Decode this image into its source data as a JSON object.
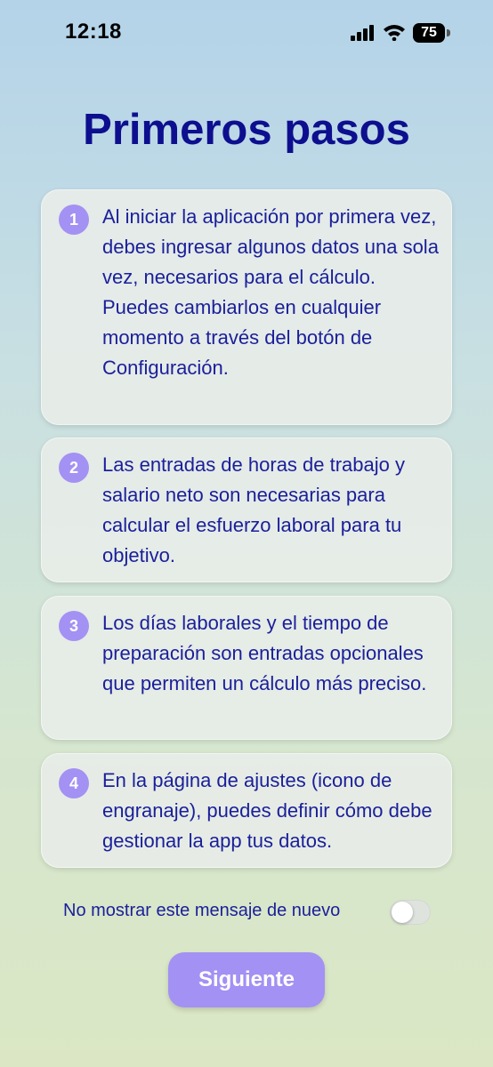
{
  "status_bar": {
    "time": "12:18",
    "battery": "75"
  },
  "title": "Primeros pasos",
  "steps": [
    {
      "number": "1",
      "text": "Al iniciar la aplicación por primera vez, debes ingresar algunos datos una sola vez, necesarios para el cálculo. Puedes cambiarlos en cualquier momento a través del botón de Configuración."
    },
    {
      "number": "2",
      "text": "Las entradas de horas de trabajo y salario neto son necesarias para calcular el esfuerzo laboral para tu objetivo."
    },
    {
      "number": "3",
      "text": "Los días laborales y el tiempo de preparación son entradas opcionales que permiten un cálculo más preciso."
    },
    {
      "number": "4",
      "text": "En la página de ajustes (icono de engranaje), puedes definir cómo debe gestionar la app tus datos."
    }
  ],
  "dont_show_again": {
    "label": "No mostrar este mensaje de nuevo",
    "checked": false
  },
  "next_button": "Siguiente",
  "colors": {
    "accent": "#a391f3",
    "text": "#1a1f9a",
    "title": "#0d0f8f"
  }
}
